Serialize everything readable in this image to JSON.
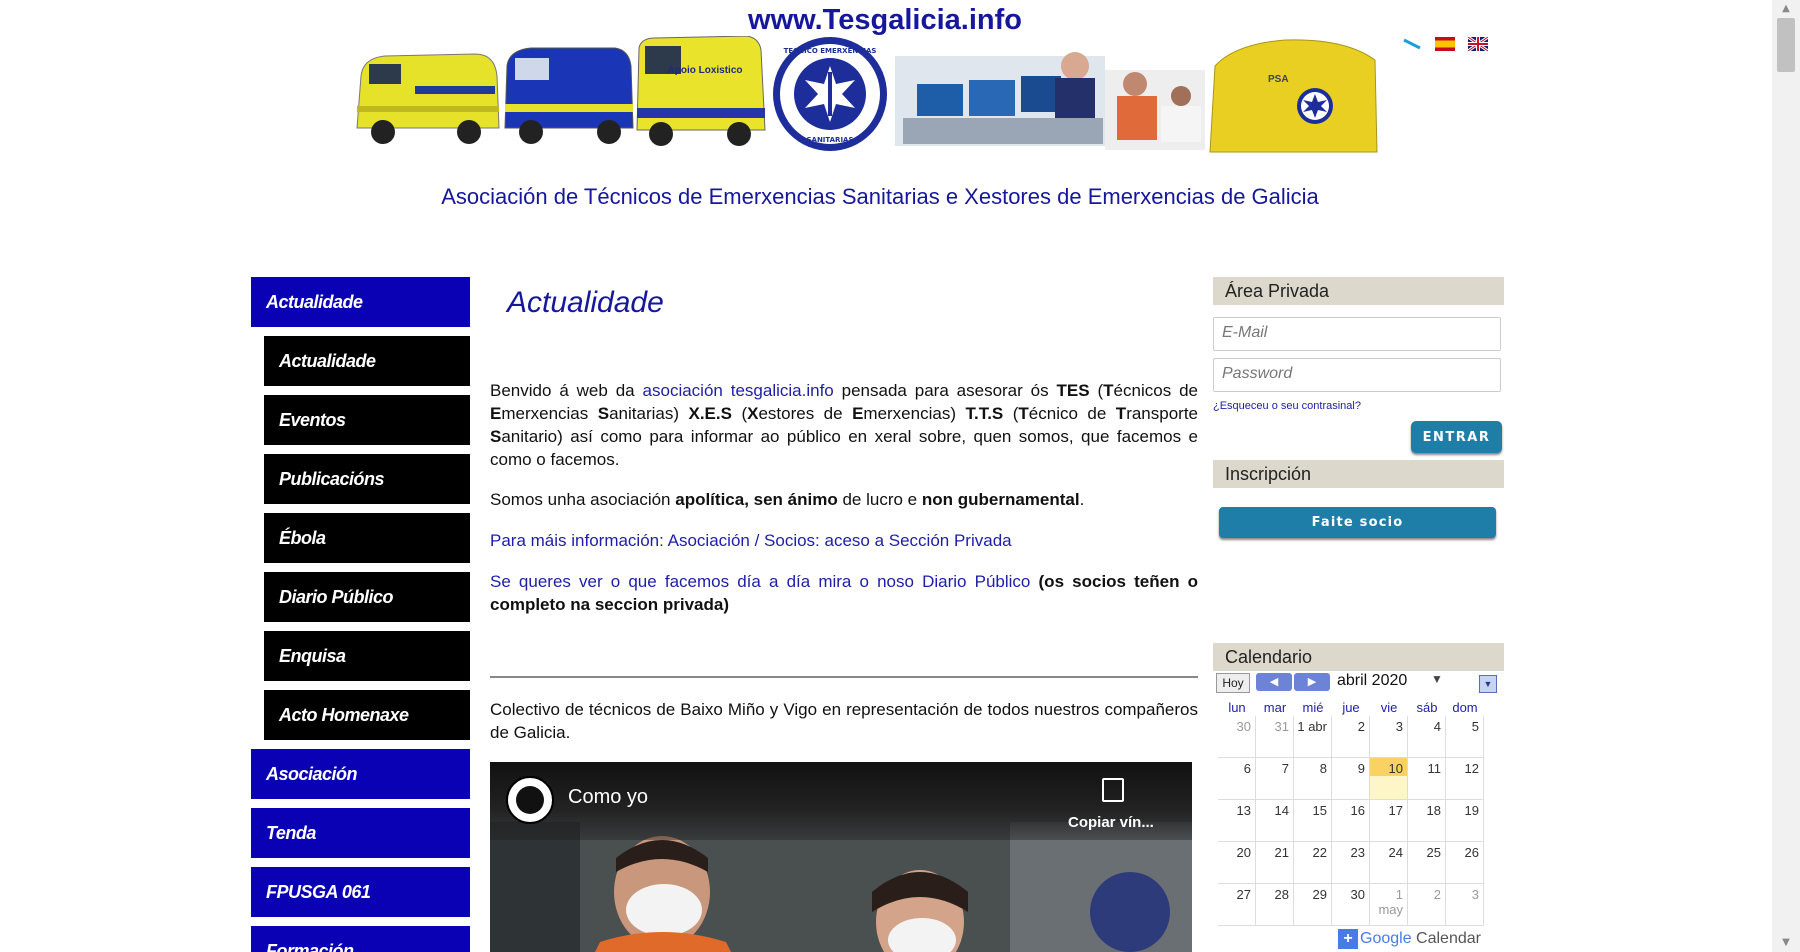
{
  "header": {
    "site_url": "www.Tesgalicia.info",
    "subtitle": "Asociación de Técnicos de Emerxencias Sanitarias e Xestores de Emerxencias de Galicia",
    "banner": {
      "van_label": "Apoio Loxistico",
      "logo_text_top": "TECNICO EMERXENCIAS",
      "logo_text_bottom": "SANITARIAS",
      "tent_label": "PSA"
    }
  },
  "languages": [
    {
      "name": "galego-flag-icon"
    },
    {
      "name": "spain-flag-icon"
    },
    {
      "name": "uk-flag-icon"
    }
  ],
  "nav": {
    "items": [
      {
        "label": "Actualidade",
        "type": "main"
      },
      {
        "label": "Actualidade",
        "type": "sub"
      },
      {
        "label": "Eventos",
        "type": "sub"
      },
      {
        "label": "Publicacións",
        "type": "sub"
      },
      {
        "label": "Ébola",
        "type": "sub"
      },
      {
        "label": "Diario Público",
        "type": "sub"
      },
      {
        "label": "Enquisa",
        "type": "sub"
      },
      {
        "label": "Acto Homenaxe",
        "type": "sub"
      },
      {
        "label": "Asociación",
        "type": "main"
      },
      {
        "label": "Tenda",
        "type": "main"
      },
      {
        "label": "FPUSGA 061",
        "type": "main"
      },
      {
        "label": "Formación",
        "type": "main"
      }
    ]
  },
  "main": {
    "heading": "Actualidade",
    "p1": {
      "t1": "Benvido á web da ",
      "link": "asociación tesgalicia.info",
      "t2": " pensada para asesorar ós ",
      "tes": "TES",
      "t3": " (",
      "t3b": "T",
      "t3c": "écnicos de ",
      "t3d": "E",
      "t3e": "merxencias ",
      "t3f": "S",
      "t3g": "anitarias) ",
      "xes": "X.E.S",
      "t4": " (",
      "t4b": "X",
      "t4c": "estores de ",
      "t4d": "E",
      "t4e": "merxencias) ",
      "tts": "T.T.S",
      "t5": " (",
      "t5b": "T",
      "t5c": "écnico de ",
      "t5d": "T",
      "t5e": "ransporte ",
      "t5f": "S",
      "t5g": "anitario) así como para informar ao público en xeral sobre, quen somos, que facemos e como o facemos."
    },
    "p2": {
      "t1": "Somos unha asociación ",
      "b1": "apolítica, sen ánimo",
      "t2": " de lucro e ",
      "b2": "non gubernamental",
      "t3": "."
    },
    "p3": {
      "t1": "Para máis información:  ",
      "link1": "Asociación",
      "t2": "   / Socios:  ",
      "link2": "aceso a Sección Privada"
    },
    "p4": {
      "t1": "Se queres ver o que facemos día a día mira o noso ",
      "link": "Diario Público",
      "t2": " (os socios teñen o completo na seccion privada)"
    },
    "p5": "Colectivo de técnicos de Baixo Miño y Vigo en representación de todos nuestros compañeros de Galicia.",
    "video": {
      "title": "Como yo",
      "copy_label": "Copiar vín..."
    }
  },
  "private_area": {
    "title": "Área Privada",
    "email_placeholder": "E-Mail",
    "password_placeholder": "Password",
    "forgot": "¿Esqueceu o seu contrasinal?",
    "submit": "ENTRAR"
  },
  "inscription": {
    "title": "Inscripción",
    "button": "Faite socio"
  },
  "calendar": {
    "title": "Calendario",
    "today_button": "Hoy",
    "month": "abril 2020",
    "weekdays": [
      "lun",
      "mar",
      "mié",
      "jue",
      "vie",
      "sáb",
      "dom"
    ],
    "weeks": [
      [
        "30",
        "31",
        "1 abr",
        "2",
        "3",
        "4",
        "5"
      ],
      [
        "6",
        "7",
        "8",
        "9",
        "10",
        "11",
        "12"
      ],
      [
        "13",
        "14",
        "15",
        "16",
        "17",
        "18",
        "19"
      ],
      [
        "20",
        "21",
        "22",
        "23",
        "24",
        "25",
        "26"
      ],
      [
        "27",
        "28",
        "29",
        "30",
        "1 may",
        "2",
        "3"
      ]
    ],
    "today": "10",
    "footer_brand": "Google",
    "footer_label": "Calendar"
  },
  "colors": {
    "nav_blue": "#0a00b4",
    "nav_black": "#000000",
    "title_blue": "#16179a",
    "button_teal": "#1f7ea8",
    "box_beige": "#dcd8cc",
    "today_yellow": "#fad163"
  }
}
